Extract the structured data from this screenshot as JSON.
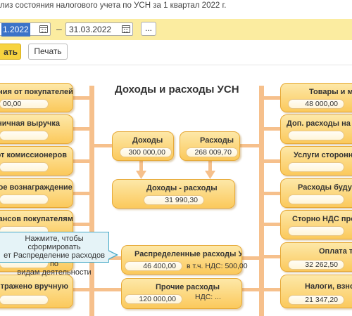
{
  "header": {
    "subtitle": "лиз состояния налогового учета по УСН за 1 квартал 2022 г."
  },
  "period": {
    "start": "1.2022",
    "separator": "–",
    "end": "31.03.2022",
    "ellipsis_label": "..."
  },
  "actions": {
    "generate_label": "ать",
    "print_label": "Печать"
  },
  "diagram": {
    "title": "Доходы и расходы УСН",
    "left_items": [
      {
        "label": "ения от покупателей",
        "value": "00,00"
      },
      {
        "label": "ничная выручка",
        "value": ""
      },
      {
        "label": "от комиссионеров",
        "value": ""
      },
      {
        "label": "ное вознаграждение",
        "value": ""
      },
      {
        "label": "вансов покупателям",
        "value": ""
      },
      {
        "label": "",
        "value": ""
      },
      {
        "label": "тражено вручную",
        "value": ""
      }
    ],
    "right_items": [
      {
        "label": "Товары и матер",
        "value": "48 000,00"
      },
      {
        "label": "Доп. расходы на приоб",
        "value": ""
      },
      {
        "label": "Услуги сторонних орг",
        "value": ""
      },
      {
        "label": "Расходы будущих",
        "value": ""
      },
      {
        "label": "Сторно НДС прошлы",
        "value": ""
      },
      {
        "label": "Оплата тру",
        "value": "32 262,50"
      },
      {
        "label": "Налоги, взносы",
        "value": "21 347,20"
      }
    ],
    "income": {
      "label": "Доходы",
      "value": "300 000,00"
    },
    "expenses": {
      "label": "Расходы",
      "value": "268 009,70"
    },
    "difference": {
      "label": "Доходы - расходы",
      "value": "31 990,30"
    },
    "distributed": {
      "label": "Распределенные расходы УСН",
      "value": "46 400,00",
      "vat": "в т.ч. НДС: 500,00"
    },
    "other": {
      "label": "Прочие расходы",
      "value": "120 000,00",
      "vat": "НДС: ..."
    },
    "tooltip": {
      "line1": "Нажмите, чтобы сформировать",
      "line2": "ет Распределение расходов по",
      "line3": "видам деятельности"
    }
  }
}
